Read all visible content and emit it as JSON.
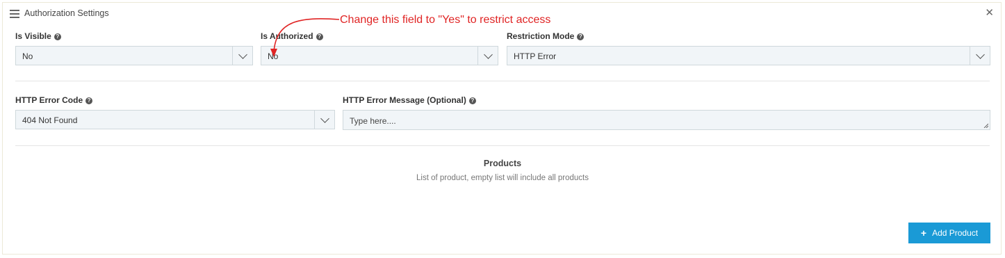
{
  "header": {
    "title": "Authorization Settings",
    "menu_icon": "hamburger-menu-icon",
    "close_icon": "close-icon",
    "close_glyph": "✕"
  },
  "help_glyph": "?",
  "fields": {
    "is_visible": {
      "label": "Is Visible",
      "value": "No"
    },
    "is_authorized": {
      "label": "Is Authorized",
      "value": "No"
    },
    "restriction_mode": {
      "label": "Restriction Mode",
      "value": "HTTP Error"
    },
    "http_error_code": {
      "label": "HTTP Error Code",
      "value": "404 Not Found"
    },
    "http_error_message": {
      "label": "HTTP Error Message (Optional)",
      "placeholder": "Type here...."
    }
  },
  "products": {
    "title": "Products",
    "subtitle": "List of product, empty list will include all products",
    "add_button": {
      "icon": "plus-icon",
      "glyph": "+",
      "label": "Add Product"
    }
  },
  "annotation": {
    "text": "Change this field to \"Yes\" to restrict access",
    "color": "#e02424"
  },
  "colors": {
    "accent": "#1a9ad6",
    "field_bg": "#f1f5f8",
    "field_border": "#cfd8dc"
  }
}
